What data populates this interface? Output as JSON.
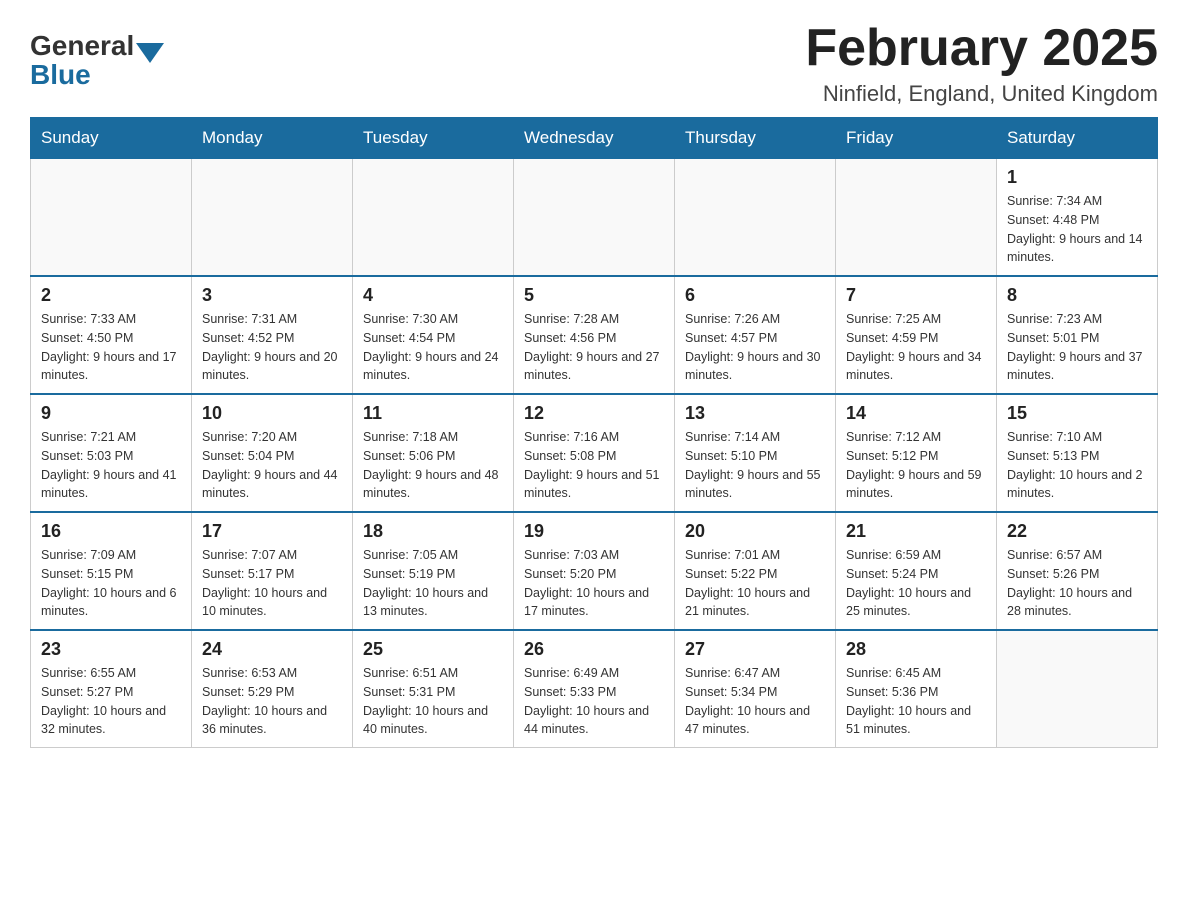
{
  "header": {
    "logo_general": "General",
    "logo_blue": "Blue",
    "title": "February 2025",
    "subtitle": "Ninfield, England, United Kingdom"
  },
  "days_of_week": [
    "Sunday",
    "Monday",
    "Tuesday",
    "Wednesday",
    "Thursday",
    "Friday",
    "Saturday"
  ],
  "weeks": [
    [
      {
        "day": "",
        "info": ""
      },
      {
        "day": "",
        "info": ""
      },
      {
        "day": "",
        "info": ""
      },
      {
        "day": "",
        "info": ""
      },
      {
        "day": "",
        "info": ""
      },
      {
        "day": "",
        "info": ""
      },
      {
        "day": "1",
        "info": "Sunrise: 7:34 AM\nSunset: 4:48 PM\nDaylight: 9 hours and 14 minutes."
      }
    ],
    [
      {
        "day": "2",
        "info": "Sunrise: 7:33 AM\nSunset: 4:50 PM\nDaylight: 9 hours and 17 minutes."
      },
      {
        "day": "3",
        "info": "Sunrise: 7:31 AM\nSunset: 4:52 PM\nDaylight: 9 hours and 20 minutes."
      },
      {
        "day": "4",
        "info": "Sunrise: 7:30 AM\nSunset: 4:54 PM\nDaylight: 9 hours and 24 minutes."
      },
      {
        "day": "5",
        "info": "Sunrise: 7:28 AM\nSunset: 4:56 PM\nDaylight: 9 hours and 27 minutes."
      },
      {
        "day": "6",
        "info": "Sunrise: 7:26 AM\nSunset: 4:57 PM\nDaylight: 9 hours and 30 minutes."
      },
      {
        "day": "7",
        "info": "Sunrise: 7:25 AM\nSunset: 4:59 PM\nDaylight: 9 hours and 34 minutes."
      },
      {
        "day": "8",
        "info": "Sunrise: 7:23 AM\nSunset: 5:01 PM\nDaylight: 9 hours and 37 minutes."
      }
    ],
    [
      {
        "day": "9",
        "info": "Sunrise: 7:21 AM\nSunset: 5:03 PM\nDaylight: 9 hours and 41 minutes."
      },
      {
        "day": "10",
        "info": "Sunrise: 7:20 AM\nSunset: 5:04 PM\nDaylight: 9 hours and 44 minutes."
      },
      {
        "day": "11",
        "info": "Sunrise: 7:18 AM\nSunset: 5:06 PM\nDaylight: 9 hours and 48 minutes."
      },
      {
        "day": "12",
        "info": "Sunrise: 7:16 AM\nSunset: 5:08 PM\nDaylight: 9 hours and 51 minutes."
      },
      {
        "day": "13",
        "info": "Sunrise: 7:14 AM\nSunset: 5:10 PM\nDaylight: 9 hours and 55 minutes."
      },
      {
        "day": "14",
        "info": "Sunrise: 7:12 AM\nSunset: 5:12 PM\nDaylight: 9 hours and 59 minutes."
      },
      {
        "day": "15",
        "info": "Sunrise: 7:10 AM\nSunset: 5:13 PM\nDaylight: 10 hours and 2 minutes."
      }
    ],
    [
      {
        "day": "16",
        "info": "Sunrise: 7:09 AM\nSunset: 5:15 PM\nDaylight: 10 hours and 6 minutes."
      },
      {
        "day": "17",
        "info": "Sunrise: 7:07 AM\nSunset: 5:17 PM\nDaylight: 10 hours and 10 minutes."
      },
      {
        "day": "18",
        "info": "Sunrise: 7:05 AM\nSunset: 5:19 PM\nDaylight: 10 hours and 13 minutes."
      },
      {
        "day": "19",
        "info": "Sunrise: 7:03 AM\nSunset: 5:20 PM\nDaylight: 10 hours and 17 minutes."
      },
      {
        "day": "20",
        "info": "Sunrise: 7:01 AM\nSunset: 5:22 PM\nDaylight: 10 hours and 21 minutes."
      },
      {
        "day": "21",
        "info": "Sunrise: 6:59 AM\nSunset: 5:24 PM\nDaylight: 10 hours and 25 minutes."
      },
      {
        "day": "22",
        "info": "Sunrise: 6:57 AM\nSunset: 5:26 PM\nDaylight: 10 hours and 28 minutes."
      }
    ],
    [
      {
        "day": "23",
        "info": "Sunrise: 6:55 AM\nSunset: 5:27 PM\nDaylight: 10 hours and 32 minutes."
      },
      {
        "day": "24",
        "info": "Sunrise: 6:53 AM\nSunset: 5:29 PM\nDaylight: 10 hours and 36 minutes."
      },
      {
        "day": "25",
        "info": "Sunrise: 6:51 AM\nSunset: 5:31 PM\nDaylight: 10 hours and 40 minutes."
      },
      {
        "day": "26",
        "info": "Sunrise: 6:49 AM\nSunset: 5:33 PM\nDaylight: 10 hours and 44 minutes."
      },
      {
        "day": "27",
        "info": "Sunrise: 6:47 AM\nSunset: 5:34 PM\nDaylight: 10 hours and 47 minutes."
      },
      {
        "day": "28",
        "info": "Sunrise: 6:45 AM\nSunset: 5:36 PM\nDaylight: 10 hours and 51 minutes."
      },
      {
        "day": "",
        "info": ""
      }
    ]
  ]
}
